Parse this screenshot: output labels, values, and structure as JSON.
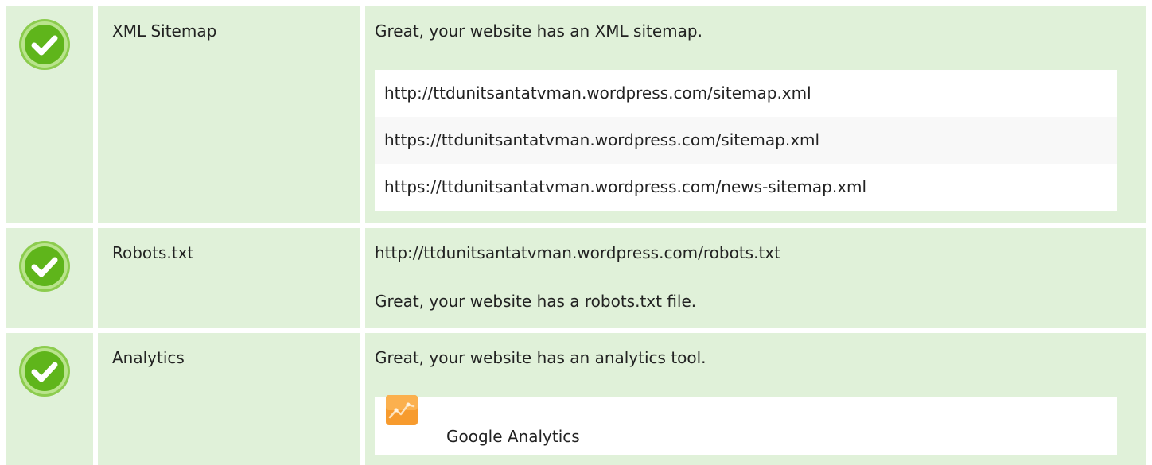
{
  "colors": {
    "row_background": "#e0f1d9",
    "check_green": "#5fb51b",
    "check_ring": "#a8dc6f",
    "analytics_orange": "#f79b2e"
  },
  "rows": [
    {
      "icon": "check-circle-icon",
      "name": "XML Sitemap",
      "message": "Great, your website has an XML sitemap.",
      "urls": [
        "http://ttdunitsantatvman.wordpress.com/sitemap.xml",
        "https://ttdunitsantatvman.wordpress.com/sitemap.xml",
        "https://ttdunitsantatvman.wordpress.com/news-sitemap.xml"
      ]
    },
    {
      "icon": "check-circle-icon",
      "name": "Robots.txt",
      "url": "http://ttdunitsantatvman.wordpress.com/robots.txt",
      "message": "Great, your website has a robots.txt file."
    },
    {
      "icon": "check-circle-icon",
      "name": "Analytics",
      "message": "Great, your website has an analytics tool.",
      "tools": [
        {
          "icon": "google-analytics-icon",
          "label": "Google Analytics"
        }
      ]
    }
  ]
}
